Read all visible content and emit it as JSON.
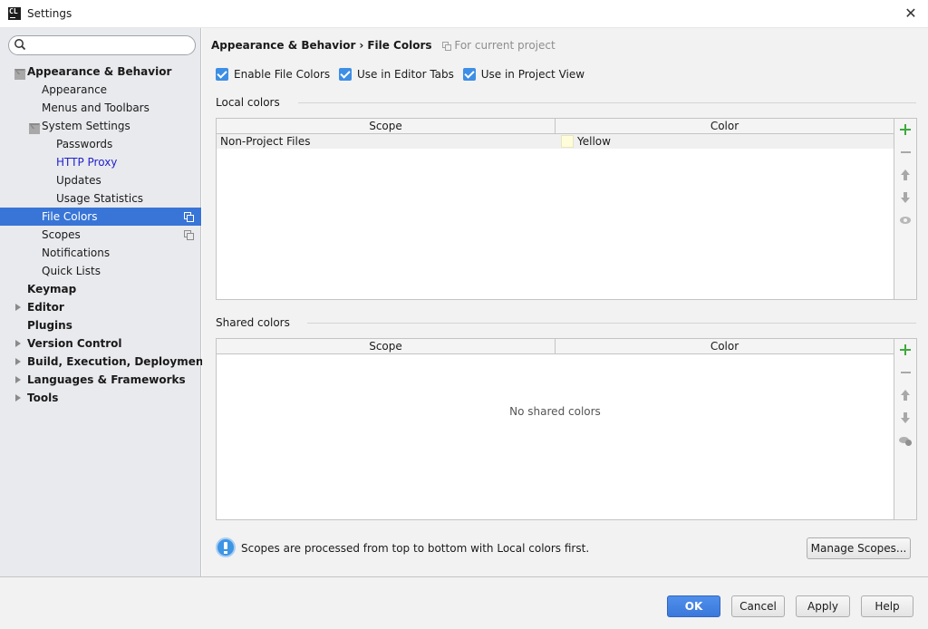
{
  "window": {
    "title": "Settings",
    "app_icon_label": "CL"
  },
  "sidebar": {
    "search_placeholder": "",
    "items": [
      {
        "label": "Appearance & Behavior",
        "bold": true,
        "expanded": true,
        "level": 0
      },
      {
        "label": "Appearance",
        "level": 1
      },
      {
        "label": "Menus and Toolbars",
        "level": 1
      },
      {
        "label": "System Settings",
        "level": 1,
        "expanded": true
      },
      {
        "label": "Passwords",
        "level": 2
      },
      {
        "label": "HTTP Proxy",
        "level": 2,
        "link": true
      },
      {
        "label": "Updates",
        "level": 2
      },
      {
        "label": "Usage Statistics",
        "level": 2
      },
      {
        "label": "File Colors",
        "level": 1,
        "selected": true,
        "project_icon": true
      },
      {
        "label": "Scopes",
        "level": 1,
        "project_icon": true
      },
      {
        "label": "Notifications",
        "level": 1
      },
      {
        "label": "Quick Lists",
        "level": 1
      },
      {
        "label": "Keymap",
        "bold": true,
        "level": 0
      },
      {
        "label": "Editor",
        "bold": true,
        "level": 0,
        "collapsed": true
      },
      {
        "label": "Plugins",
        "bold": true,
        "level": 0
      },
      {
        "label": "Version Control",
        "bold": true,
        "level": 0,
        "collapsed": true
      },
      {
        "label": "Build, Execution, Deployment",
        "bold": true,
        "level": 0,
        "collapsed": true
      },
      {
        "label": "Languages & Frameworks",
        "bold": true,
        "level": 0,
        "collapsed": true
      },
      {
        "label": "Tools",
        "bold": true,
        "level": 0,
        "collapsed": true
      }
    ]
  },
  "breadcrumb": {
    "parent": "Appearance & Behavior",
    "separator": "›",
    "current": "File Colors",
    "project_note": "For current project"
  },
  "options": {
    "enable_file_colors": {
      "label": "Enable File Colors",
      "checked": true
    },
    "use_in_editor_tabs": {
      "label": "Use in Editor Tabs",
      "checked": true
    },
    "use_in_project_view": {
      "label": "Use in Project View",
      "checked": true
    }
  },
  "local_colors": {
    "title": "Local colors",
    "columns": [
      "Scope",
      "Color"
    ],
    "rows": [
      {
        "scope": "Non-Project Files",
        "color": "Yellow",
        "swatch": "#fefcd9"
      }
    ]
  },
  "shared_colors": {
    "title": "Shared colors",
    "columns": [
      "Scope",
      "Color"
    ],
    "empty_text": "No shared colors"
  },
  "info": {
    "text": "Scopes are processed from top to bottom with Local colors first."
  },
  "buttons": {
    "manage_scopes": "Manage Scopes...",
    "ok": "OK",
    "cancel": "Cancel",
    "apply": "Apply",
    "help": "Help"
  },
  "colors": {
    "selection": "#3875d7",
    "primary_button": "#3b78db",
    "checkbox": "#3d8ee5",
    "add_icon": "#3ea93e",
    "link": "#2222cc"
  }
}
